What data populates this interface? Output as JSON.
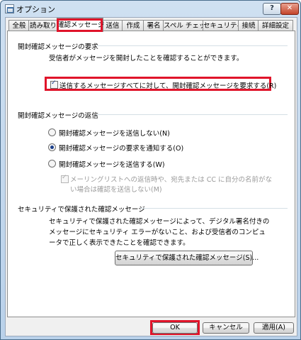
{
  "window": {
    "title": "オプション",
    "help_label": "?",
    "close_label": "✕"
  },
  "tabs": [
    "全般",
    "読み取り",
    "確認メッセージ",
    "送信",
    "作成",
    "署名",
    "スペル チェック",
    "セキュリティ",
    "接続",
    "詳細設定"
  ],
  "request_section": {
    "title": "開封確認メッセージの要求",
    "description": "受信者がメッセージを開封したことを確認することができます。",
    "checkbox_label": "送信するメッセージすべてに対して、開封確認メッセージを要求する(R)",
    "checked": true
  },
  "return_section": {
    "title": "開封確認メッセージの返信",
    "options": [
      {
        "label": "開封確認メッセージを送信しない(N)",
        "selected": false
      },
      {
        "label": "開封確認メッセージの要求を通知する(O)",
        "selected": true
      },
      {
        "label": "開封確認メッセージを送信する(W)",
        "selected": false
      }
    ],
    "sub_checkbox_line1": "メーリングリストへの返信時や、宛先または CC に自分の名前がな",
    "sub_checkbox_line2": "い場合は確認を送信しない(M)",
    "sub_checked": true
  },
  "secure_section": {
    "title": "セキュリティで保護された確認メッセージ",
    "description_lines": [
      "セキュリティで保護された確認メッセージによって、デジタル署名付きの",
      "メッセージにセキュリティ エラーがないこと、および受信者のコンピュ",
      "ータで正しく表示できたことを確認できます。"
    ],
    "button_label": "セキュリティで保護された確認メッセージ(S)..."
  },
  "footer": {
    "ok_label": "OK",
    "cancel_label": "キャンセル",
    "apply_label": "適用(A)"
  },
  "colors": {
    "highlight": "#e0142a",
    "title_bar": "#b9d1ea"
  }
}
